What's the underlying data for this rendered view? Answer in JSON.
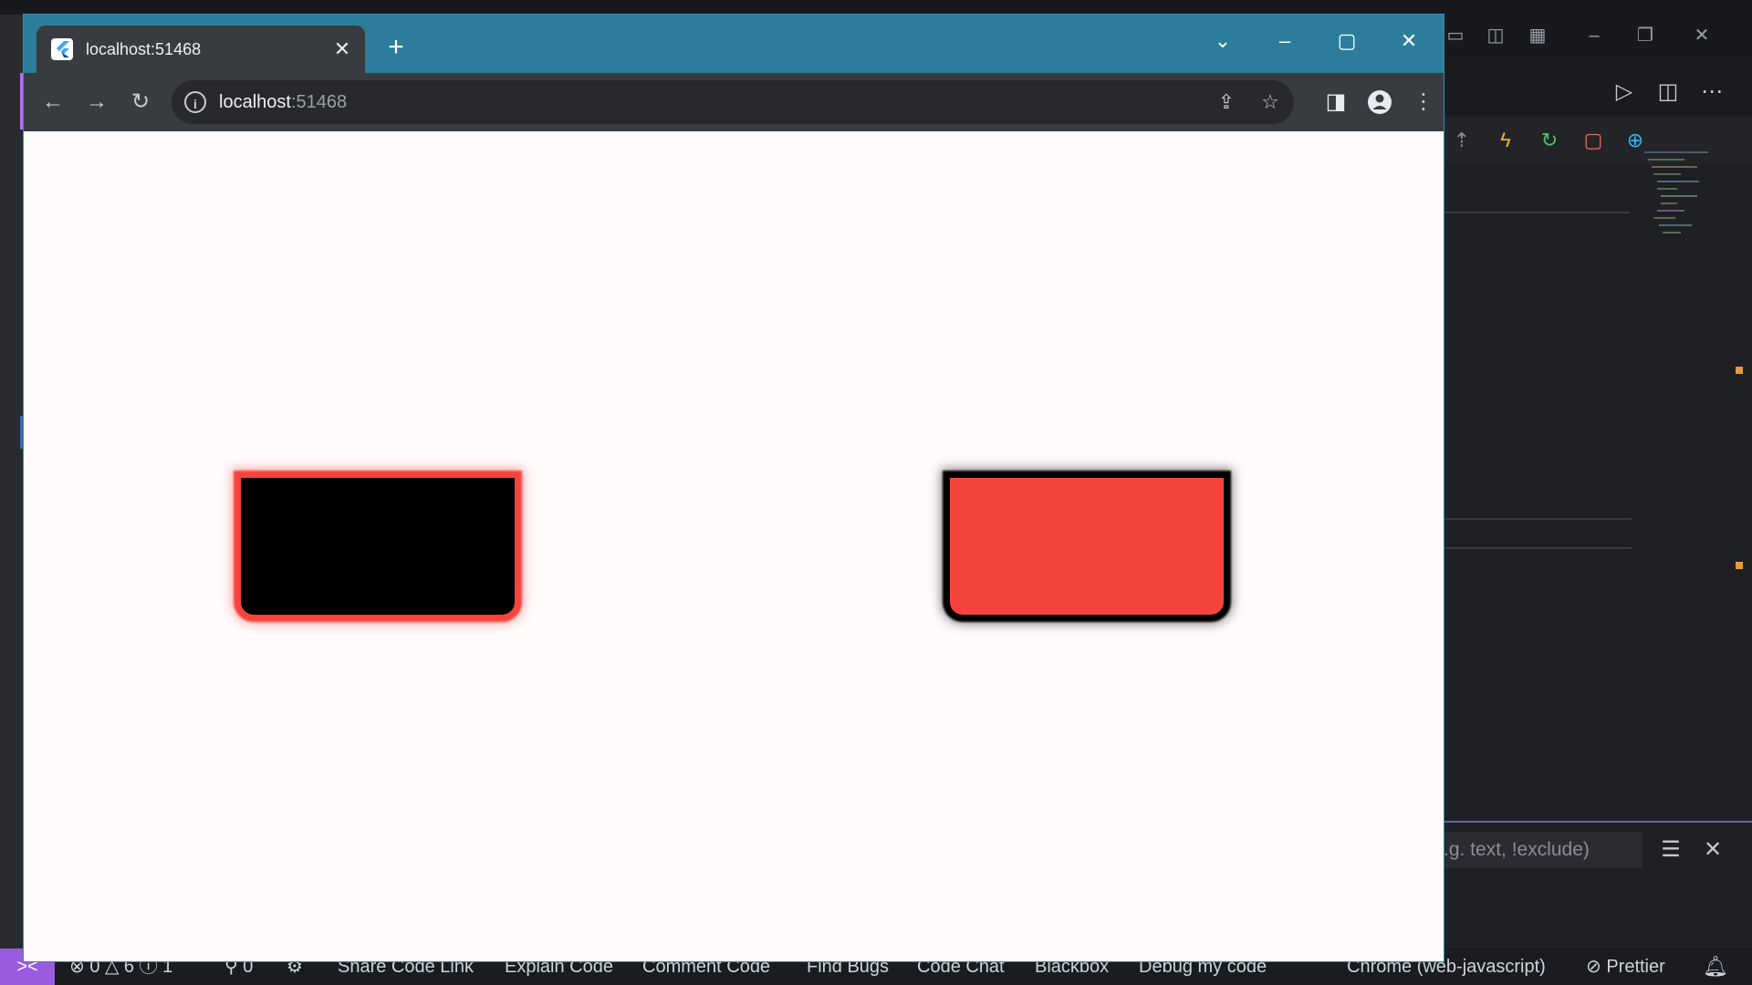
{
  "browser": {
    "tab_title": "localhost:51468",
    "url_host": "localhost",
    "url_port": ":51468",
    "tab_close_icon": "close-icon",
    "new_tab_icon": "plus-icon"
  },
  "page": {
    "boxes": [
      {
        "name": "black-box-red-shadow",
        "fill": "#000000",
        "shadow": "#f6443c"
      },
      {
        "name": "red-box-black-shadow",
        "fill": "#f6443c",
        "shadow": "#000000"
      }
    ]
  },
  "vscode": {
    "filter_placeholder": ".g. text, !exclude)",
    "status": {
      "remote": "><",
      "problems": "⊗ 0 △ 6 ⓘ 1",
      "ports": "⚲ 0",
      "items": [
        "Share Code Link",
        "Explain Code",
        "Comment Code",
        "Find Bugs",
        "Code Chat",
        "Blackbox",
        "Debug my code"
      ],
      "debug_target": "Chrome (web-javascript)",
      "prettier": "⊘ Prettier"
    }
  },
  "colors": {
    "titlebar": "#2b7d9b",
    "toolbar": "#383b3f",
    "accent_red": "#f6443c",
    "remote_purple": "#9a5be0"
  }
}
